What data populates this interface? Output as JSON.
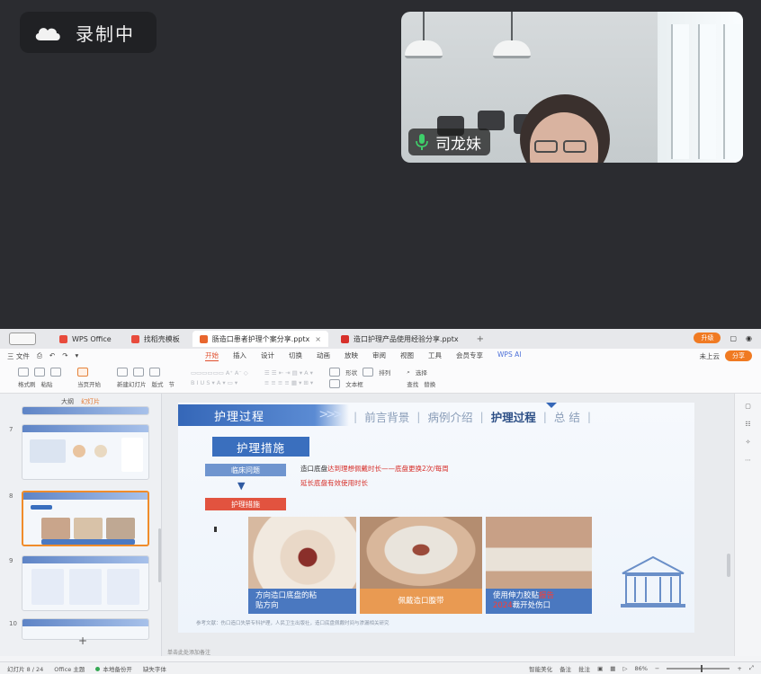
{
  "recording": {
    "label": "录制中",
    "icon": "cloud-icon"
  },
  "video": {
    "participant_name": "司龙妹",
    "mic_icon": "microphone-icon"
  },
  "wps": {
    "tabs": [
      {
        "label": "WPS Office",
        "color": "#e84b3c"
      },
      {
        "label": "找稻壳模板",
        "color": "#e84b3c"
      },
      {
        "label": "肠造口患者护理个案分享.pptx",
        "color": "#e8662e",
        "active": true
      },
      {
        "label": "造口护理产品使用经验分享.pptx",
        "color": "#d7302a"
      }
    ],
    "tab_add": "+",
    "top_right": {
      "upgrade": "升级",
      "share": "分享"
    },
    "menu_left": [
      "三 文件",
      "⎙",
      "↶",
      "↷",
      "▾"
    ],
    "menu_main": [
      "开始",
      "插入",
      "设计",
      "切换",
      "动画",
      "放映",
      "审阅",
      "视图",
      "工具",
      "会员专享",
      "WPS AI"
    ],
    "menu_right": [
      "未上云",
      "分享"
    ],
    "ribbon": {
      "format_painter": "格式刷",
      "paste": "粘贴",
      "current_page_start": "当页开始",
      "new_slide": "新建幻灯片",
      "layout": "版式",
      "section": "节",
      "shape": "形状",
      "arrange": "排列",
      "textbox": "文本框",
      "find": "查找",
      "replace": "替换",
      "select": "选择"
    },
    "thumbs": {
      "header": {
        "outline": "大纲",
        "slides": "幻灯片"
      },
      "numbers": [
        "7",
        "8",
        "9",
        "10"
      ]
    },
    "slide": {
      "title": "护理过程",
      "nav": [
        "前言背景",
        "病例介绍",
        "护理过程",
        "总  结"
      ],
      "section_heading": "护理措施",
      "pill_problem": "临床问题",
      "pill_measure": "护理措施",
      "note1_prefix": "造口底盘",
      "note1_red": "达到理想佩戴时长",
      "note1_suffix": "——底盘更换2次/每周",
      "note2": "延长底盘有效使用时长",
      "captions": [
        {
          "text": "方向造口底盘的粘",
          "text2": "贴方向"
        },
        {
          "text": "佩戴造口腹带",
          "text2": ""
        },
        {
          "text_prefix": "使用伸力胶贴",
          "text_red": "报告",
          "text_line2_red": "2024",
          "text_line2": "裁开处伤口"
        }
      ],
      "footer_note": "参考文献：伤口造口失禁专科护理，人民卫生出版社，造口底盘佩戴时间与渗漏相关研究"
    },
    "notes_placeholder": "单击此处添加备注",
    "status": {
      "page": "幻灯片 8 / 24",
      "theme": "Office 主题",
      "backup": "本地备份开",
      "missing_fonts": "缺失字体",
      "smart_beautify": "智能美化",
      "notes": "备注",
      "comment": "批注",
      "zoom": "86%"
    }
  }
}
